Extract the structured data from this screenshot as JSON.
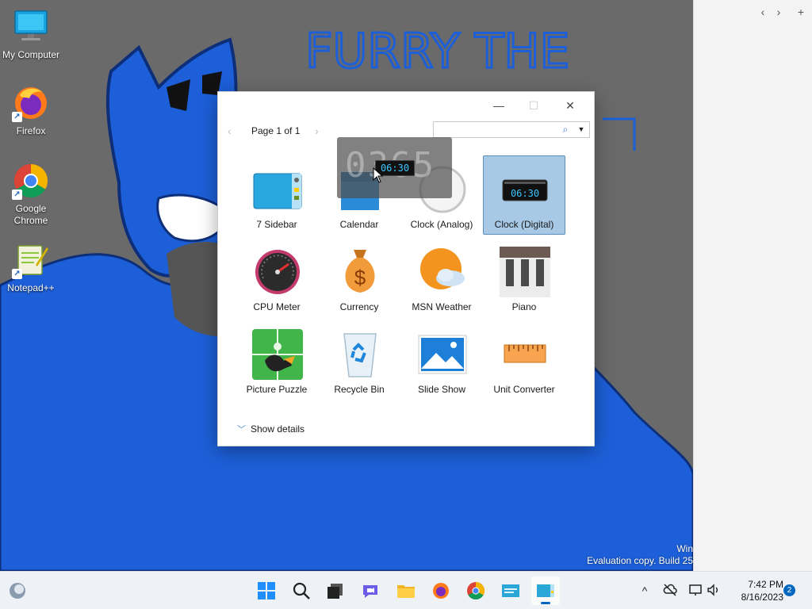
{
  "desktop": {
    "wallpaper_text": "FURRY THE",
    "watermark": {
      "line1": "Win",
      "line2": "Evaluation copy. Build 25"
    },
    "icons": [
      {
        "label": "My Computer",
        "icon": "computer-icon"
      },
      {
        "label": "Firefox",
        "icon": "firefox-icon"
      },
      {
        "label": "Google Chrome",
        "icon": "chrome-icon"
      },
      {
        "label": "Notepad++",
        "icon": "notepad-plus-plus-icon"
      }
    ]
  },
  "side_panel": {
    "back": "‹",
    "forward": "›",
    "add": "+"
  },
  "gallery": {
    "window": {
      "minimize": "—",
      "maximize": "☐",
      "close": "✕"
    },
    "pager": {
      "prev": "‹",
      "label": "Page 1 of 1",
      "next": "›"
    },
    "search": {
      "value": "",
      "placeholder": "",
      "icon": "search-icon"
    },
    "gadgets": [
      {
        "label": "7 Sidebar",
        "icon": "sidebar-icon",
        "selected": false
      },
      {
        "label": "Calendar",
        "icon": "calendar-icon",
        "selected": false
      },
      {
        "label": "Clock (Analog)",
        "icon": "analog-clock-icon",
        "selected": false
      },
      {
        "label": "Clock (Digital)",
        "icon": "digital-clock-icon",
        "selected": true
      },
      {
        "label": "CPU Meter",
        "icon": "cpu-meter-icon",
        "selected": false
      },
      {
        "label": "Currency",
        "icon": "currency-icon",
        "selected": false
      },
      {
        "label": "MSN Weather",
        "icon": "weather-icon",
        "selected": false
      },
      {
        "label": "Piano",
        "icon": "piano-icon",
        "selected": false
      },
      {
        "label": "Picture Puzzle",
        "icon": "picture-puzzle-icon",
        "selected": false
      },
      {
        "label": "Recycle Bin",
        "icon": "recycle-bin-icon",
        "selected": false
      },
      {
        "label": "Slide Show",
        "icon": "slide-show-icon",
        "selected": false
      },
      {
        "label": "Unit Converter",
        "icon": "unit-converter-icon",
        "selected": false
      }
    ],
    "digital_time": "06:30",
    "show_details": "Show details"
  },
  "drag_ghost": {
    "time": "06:30",
    "blurred_digits": "0365"
  },
  "taskbar": {
    "apps": [
      "widgets-icon",
      "start-icon",
      "search-icon",
      "task-view-icon",
      "chat-icon",
      "file-explorer-icon",
      "firefox-icon",
      "chrome-icon",
      "gadgets-icon",
      "gadget-gallery-icon"
    ],
    "tray": {
      "chevron": "^",
      "icons": [
        "onedrive-icon",
        "network-icon",
        "volume-icon"
      ]
    },
    "clock": {
      "time": "7:42 PM",
      "date": "8/16/2023"
    },
    "notifications": "2"
  },
  "colors": {
    "selection": "#a8c9e6",
    "accent": "#0067c0",
    "wallpaper_blue": "#1d5fd8"
  }
}
